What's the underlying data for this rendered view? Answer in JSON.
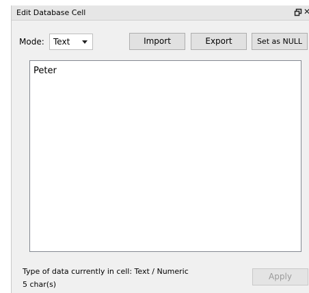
{
  "title": "Edit Database Cell",
  "toolbar": {
    "mode_label": "Mode:",
    "mode_value": "Text",
    "import_label": "Import",
    "export_label": "Export",
    "null_label": "Set as NULL"
  },
  "editor": {
    "value": "Peter"
  },
  "status": {
    "type_text": "Type of data currently in cell: Text / Numeric",
    "count_text": "5 char(s)"
  },
  "apply_label": "Apply",
  "icons": {
    "float": "float-window-icon",
    "close": "close-icon"
  }
}
